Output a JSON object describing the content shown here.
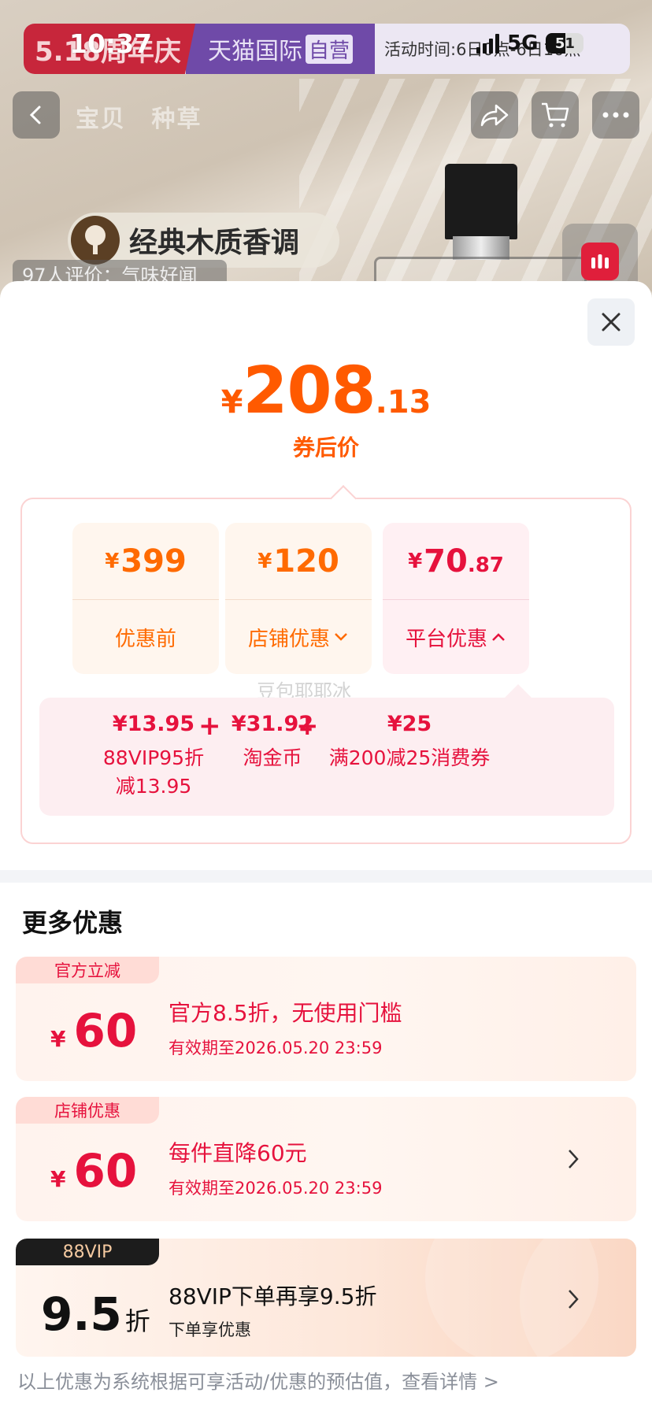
{
  "status_bar": {
    "time": "10:37",
    "network": "5G",
    "battery": "51",
    "battery_level": 0.51
  },
  "banner": {
    "left": "5.18周年庆",
    "brand": "天猫国际",
    "brand_tag": "自营",
    "time_text": "活动时间:6日0点-6日10点"
  },
  "nav": {
    "tabs": [
      "宝贝",
      "种草"
    ]
  },
  "product": {
    "note": "经典木质香调",
    "review": "97人评价：气味好闻"
  },
  "price": {
    "currency": "¥",
    "integer": "208",
    "decimal": ".13",
    "label": "券后价"
  },
  "breakdown": {
    "items": [
      {
        "currency": "¥",
        "integer": "399",
        "decimal": "",
        "label": "优惠前"
      },
      {
        "currency": "¥",
        "integer": "120",
        "decimal": "",
        "label": "店铺优惠"
      },
      {
        "currency": "¥",
        "integer": "70",
        "decimal": ".87",
        "label": "平台优惠"
      }
    ],
    "operators": [
      "-",
      "-"
    ],
    "watermark": "豆包耶耶冰"
  },
  "platform_detail": {
    "items": [
      {
        "value": "¥13.95",
        "text": "88VIP95折\n减13.95"
      },
      {
        "value": "¥31.92",
        "text": "淘金币"
      },
      {
        "value": "¥25",
        "text": "满200减25消费券"
      }
    ],
    "operators": [
      "+",
      "+"
    ]
  },
  "more": {
    "title": "更多优惠",
    "offers": [
      {
        "badge": "官方立减",
        "currency": "¥",
        "amount": "60",
        "title": "官方8.5折，无使用门槛",
        "validity": "有效期至2026.05.20 23:59"
      },
      {
        "badge": "店铺优惠",
        "currency": "¥",
        "amount": "60",
        "title": "每件直降60元",
        "validity": "有效期至2026.05.20 23:59"
      }
    ],
    "vip": {
      "badge": "88VIP",
      "amount": "9.5",
      "unit": "折",
      "title": "88VIP下单再享9.5折",
      "sub": "下单享优惠"
    }
  },
  "footnote": "以上优惠为系统根据可享活动/优惠的预估值，查看详情 >",
  "colors": {
    "orange": "#ff5a00",
    "red": "#e6123d"
  }
}
